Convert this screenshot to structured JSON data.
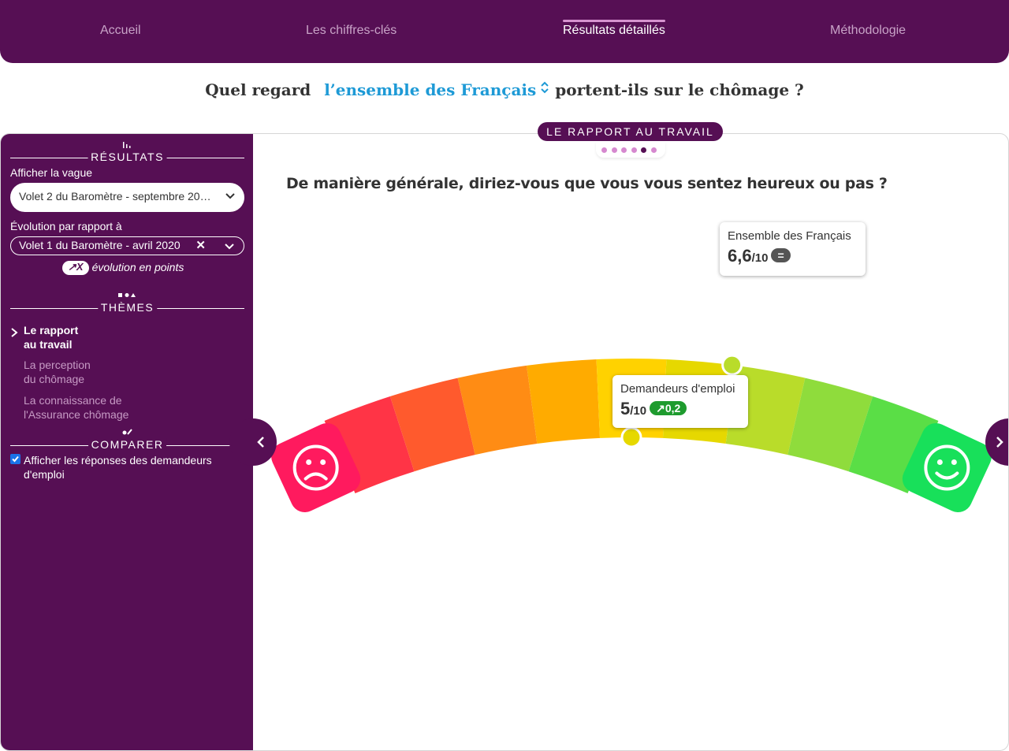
{
  "nav": {
    "tabs": [
      {
        "label": "Accueil",
        "active": false
      },
      {
        "label": "Les chiffres-clés",
        "active": false
      },
      {
        "label": "Résultats détaillés",
        "active": true
      },
      {
        "label": "Méthodologie",
        "active": false
      }
    ]
  },
  "header": {
    "q_before": "Quel regard",
    "population": "l’ensemble des Français",
    "q_after": "portent-ils sur le chômage ?"
  },
  "section_tab": {
    "label": "LE RAPPORT AU TRAVAIL",
    "dots_total": 6,
    "active_dot": 5
  },
  "sidebar": {
    "resultats_title": "RÉSULTATS",
    "afficher_label": "Afficher la vague",
    "vague_selected": "Volet 2 du Baromètre - septembre 20…",
    "evolution_label": "Évolution par rapport à",
    "evolution_selected": "Volet 1 du Baromètre - avril 2020",
    "legend_pill": "↗X",
    "legend_text": "évolution en points",
    "themes_title": "THÈMES",
    "themes": [
      {
        "label_line1": "Le rapport",
        "label_line2": "au travail",
        "active": true
      },
      {
        "label_line1": "La perception",
        "label_line2": "du chômage",
        "active": false
      },
      {
        "label_line1": "La connaissance de",
        "label_line2": "l'Assurance chômage",
        "active": false
      }
    ],
    "comparer_title": "COMPARER",
    "compare_checkbox_label": "Afficher les réponses des demandeurs d'emploi",
    "compare_checked": true
  },
  "main": {
    "question": "De manière générale, diriez-vous que vous vous sentez heureux ou pas ?",
    "scale_max": 10,
    "gauge_colors": [
      "#ff1a5e",
      "#ff3446",
      "#ff5a2d",
      "#ff8c14",
      "#ffab00",
      "#ffd200",
      "#e6d800",
      "#b9dc2a",
      "#8fdc3c",
      "#5ade46",
      "#18e05a"
    ],
    "results": [
      {
        "name": "Ensemble des Français",
        "value": 6.6,
        "value_text": "6,6",
        "scale_text": "/10",
        "delta_text": "=",
        "badge_color": "#555555",
        "marker_color": "#b9dc2a"
      },
      {
        "name": "Demandeurs d'emploi",
        "value": 5.0,
        "value_text": "5",
        "scale_text": "/10",
        "delta_text": "↗0,2",
        "badge_color": "#1e9b2e",
        "marker_color": "#e6d800"
      }
    ]
  }
}
